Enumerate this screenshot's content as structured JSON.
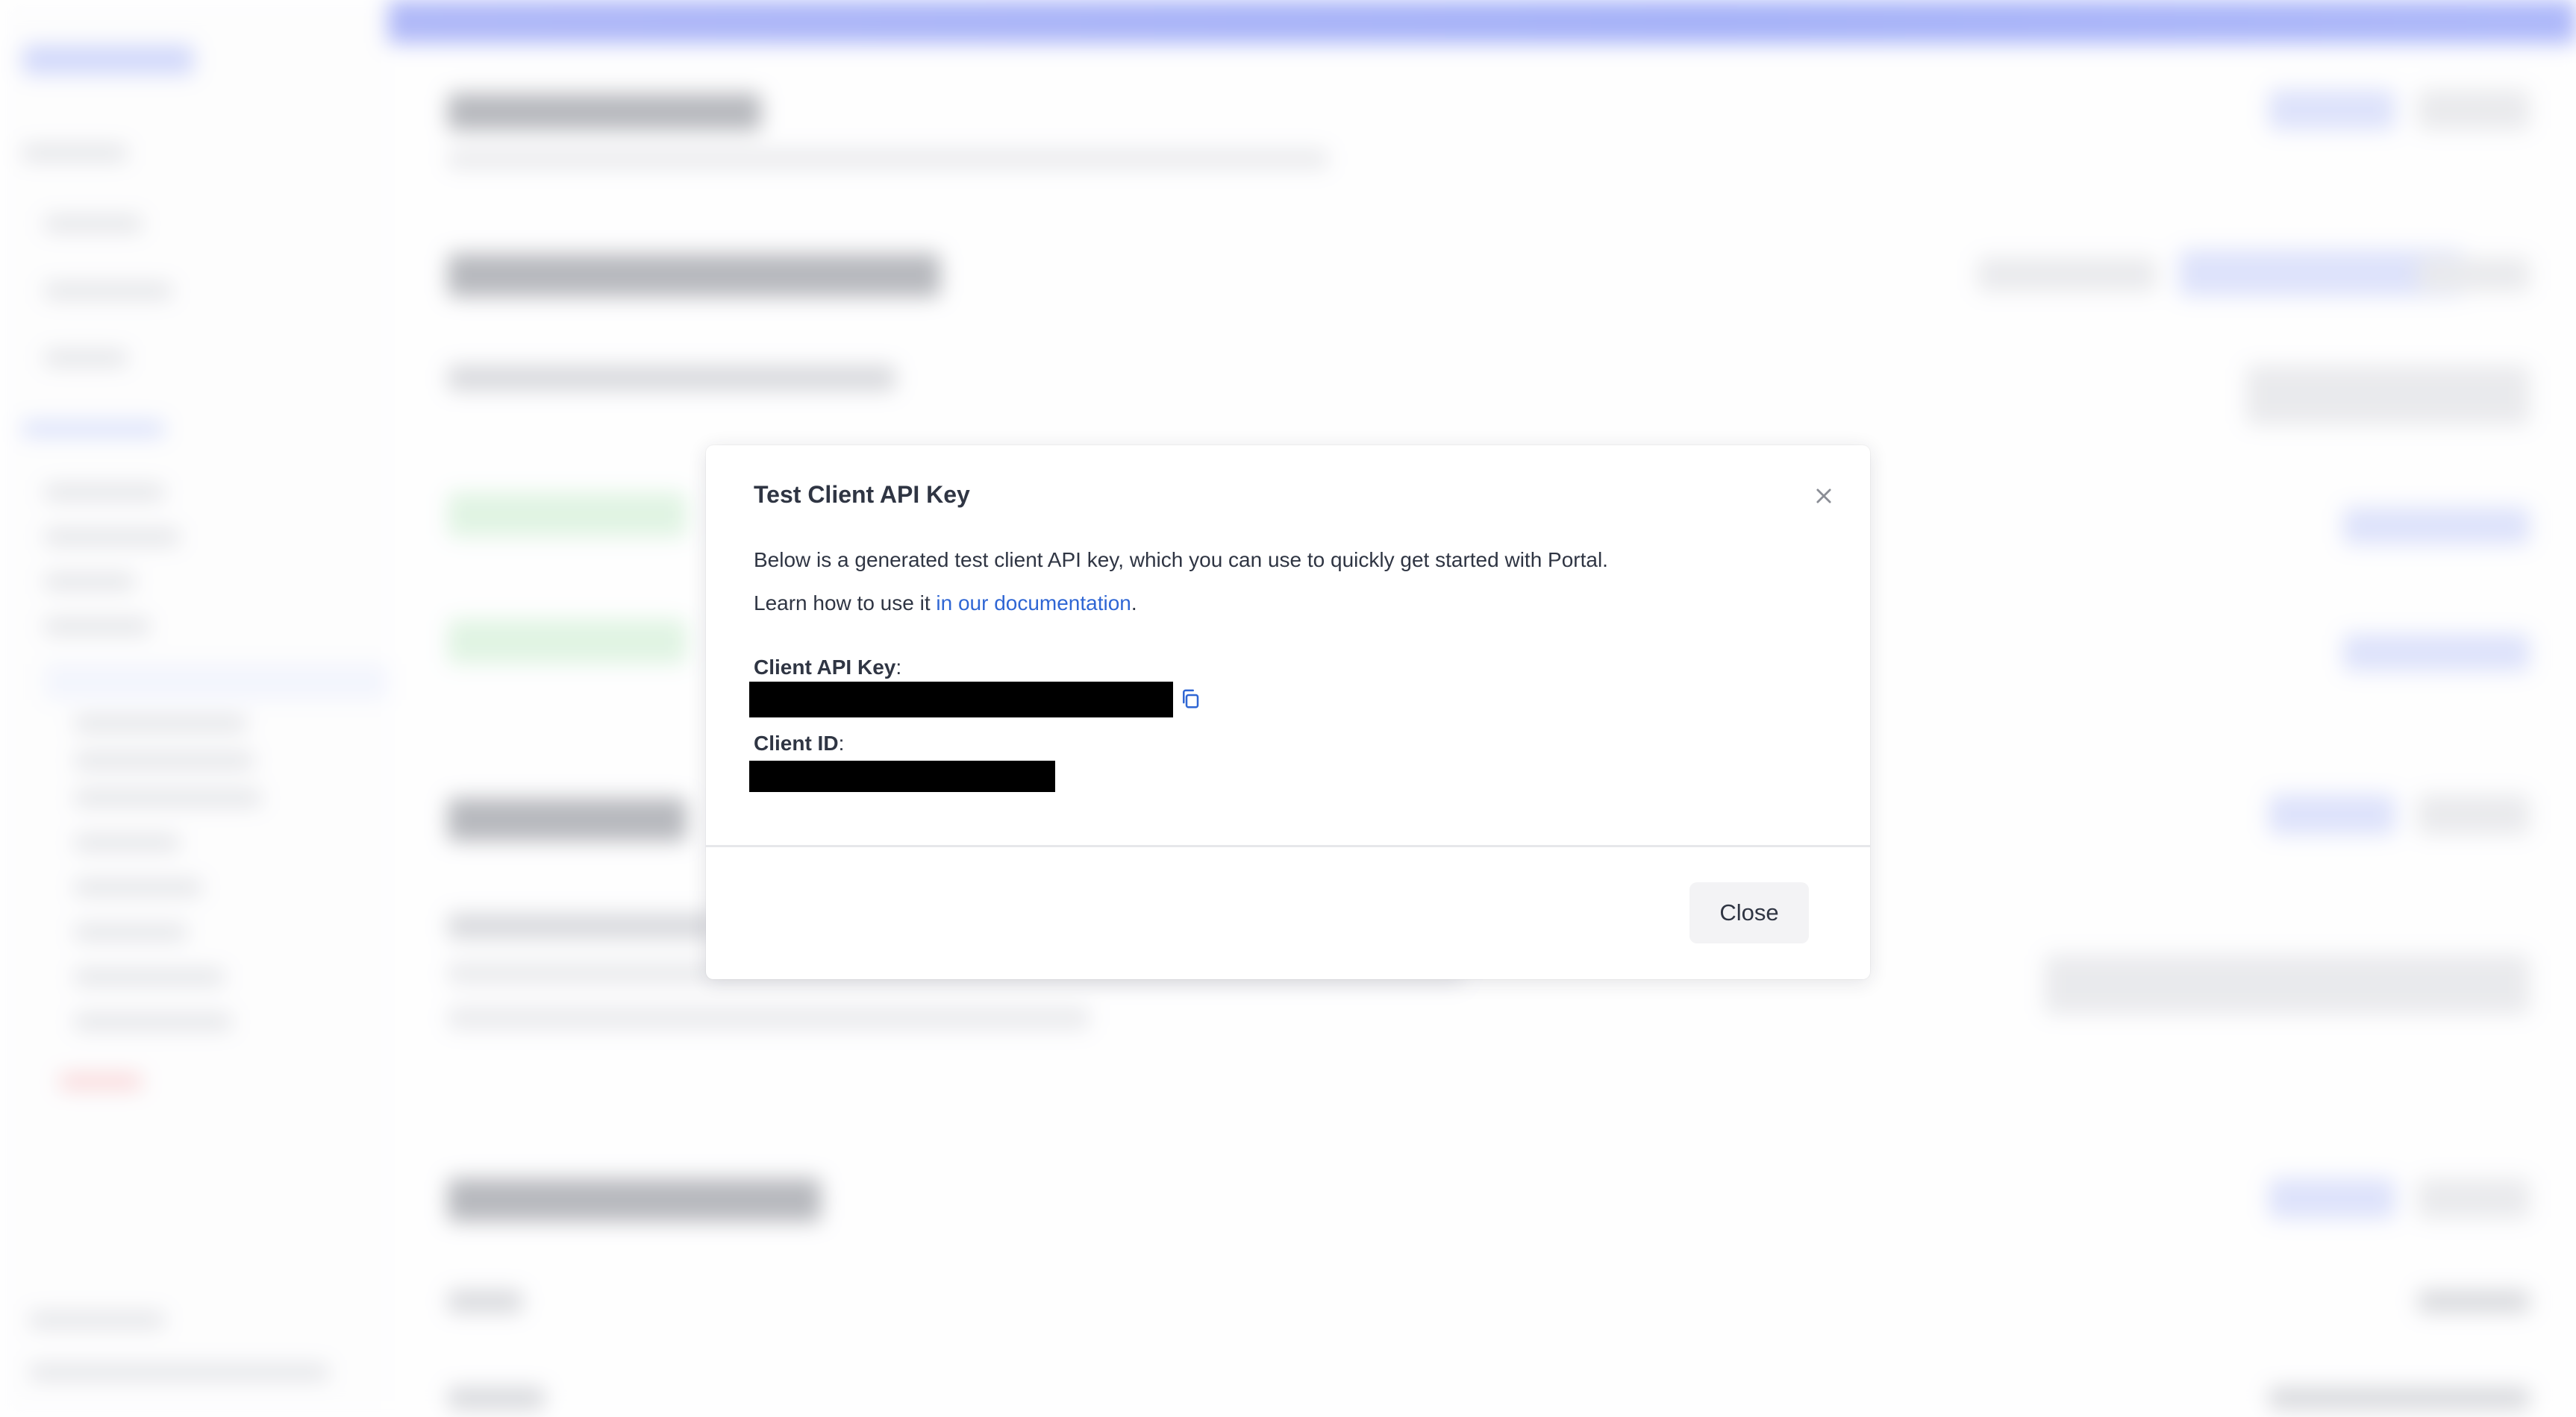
{
  "modal": {
    "title": "Test Client API Key",
    "description": "Below is a generated test client API key, which you can use to quickly get started with Portal.",
    "learn_prefix": "Learn how to use it ",
    "learn_link": "in our documentation",
    "learn_suffix": ".",
    "api_key_label": "Client API Key",
    "client_id_label": "Client ID",
    "label_colon": ":",
    "close_label": "Close"
  },
  "icons": {
    "close": "close-icon",
    "copy": "copy-icon"
  },
  "colors": {
    "link": "#2f66d4",
    "text": "#2f3543",
    "accent": "#5d73f3"
  }
}
